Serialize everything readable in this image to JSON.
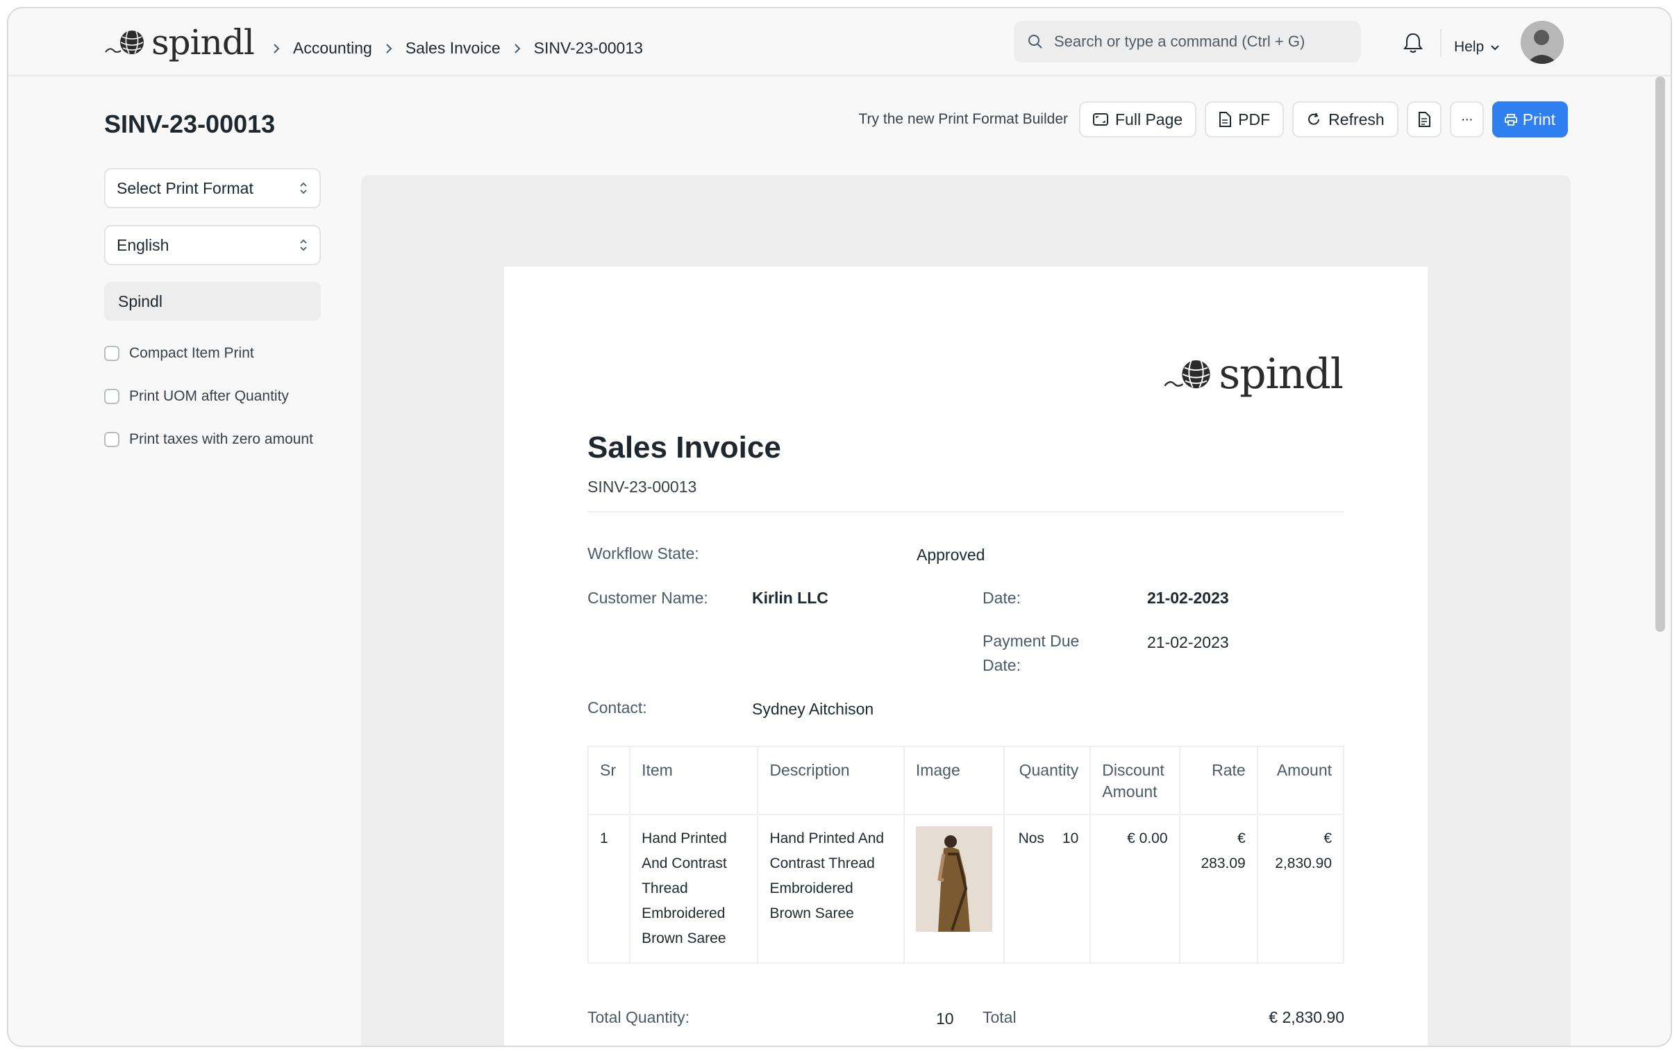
{
  "navbar": {
    "logo_text": "spindl",
    "breadcrumbs": [
      "Accounting",
      "Sales Invoice",
      "SINV-23-00013"
    ],
    "search_placeholder": "Search or type a command (Ctrl + G)",
    "help_label": "Help"
  },
  "page": {
    "title": "SINV-23-00013",
    "try_builder": "Try the new Print Format Builder",
    "full_page_label": "Full Page",
    "pdf_label": "PDF",
    "refresh_label": "Refresh",
    "more_label": "···",
    "print_label": "Print"
  },
  "sidebar": {
    "print_format": "Select Print Format",
    "language": "English",
    "letterhead": "Spindl",
    "checkboxes": [
      "Compact Item Print",
      "Print UOM after Quantity",
      "Print taxes with zero amount"
    ]
  },
  "document": {
    "logo_text": "spindl",
    "title": "Sales Invoice",
    "name": "SINV-23-00013",
    "workflow_state_label": "Workflow State:",
    "workflow_state": "Approved",
    "customer_label": "Customer Name:",
    "customer": "Kirlin LLC",
    "date_label": "Date:",
    "date": "21-02-2023",
    "due_label_1": "Payment Due",
    "due_label_2": "Date:",
    "due_date": "21-02-2023",
    "contact_label": "Contact:",
    "contact": "Sydney Aitchison",
    "table": {
      "headers": [
        "Sr",
        "Item",
        "Description",
        "Image",
        "Quantity",
        "Discount Amount",
        "Rate",
        "Amount"
      ],
      "rows": [
        {
          "sr": "1",
          "item": "Hand Printed And Contrast Thread Embroidered Brown Saree",
          "description": "Hand Printed And Contrast Thread Embroidered Brown Saree",
          "uom": "Nos",
          "qty": "10",
          "discount": "€ 0.00",
          "rate_cur": "€",
          "rate": "283.09",
          "amount_cur": "€",
          "amount": "2,830.90"
        }
      ]
    },
    "total_qty_label": "Total Quantity:",
    "total_qty": "10",
    "total_label": "Total",
    "total": "€ 2,830.90"
  },
  "colors": {
    "primary": "#2f7ff0",
    "preview_bg": "#ededee"
  }
}
